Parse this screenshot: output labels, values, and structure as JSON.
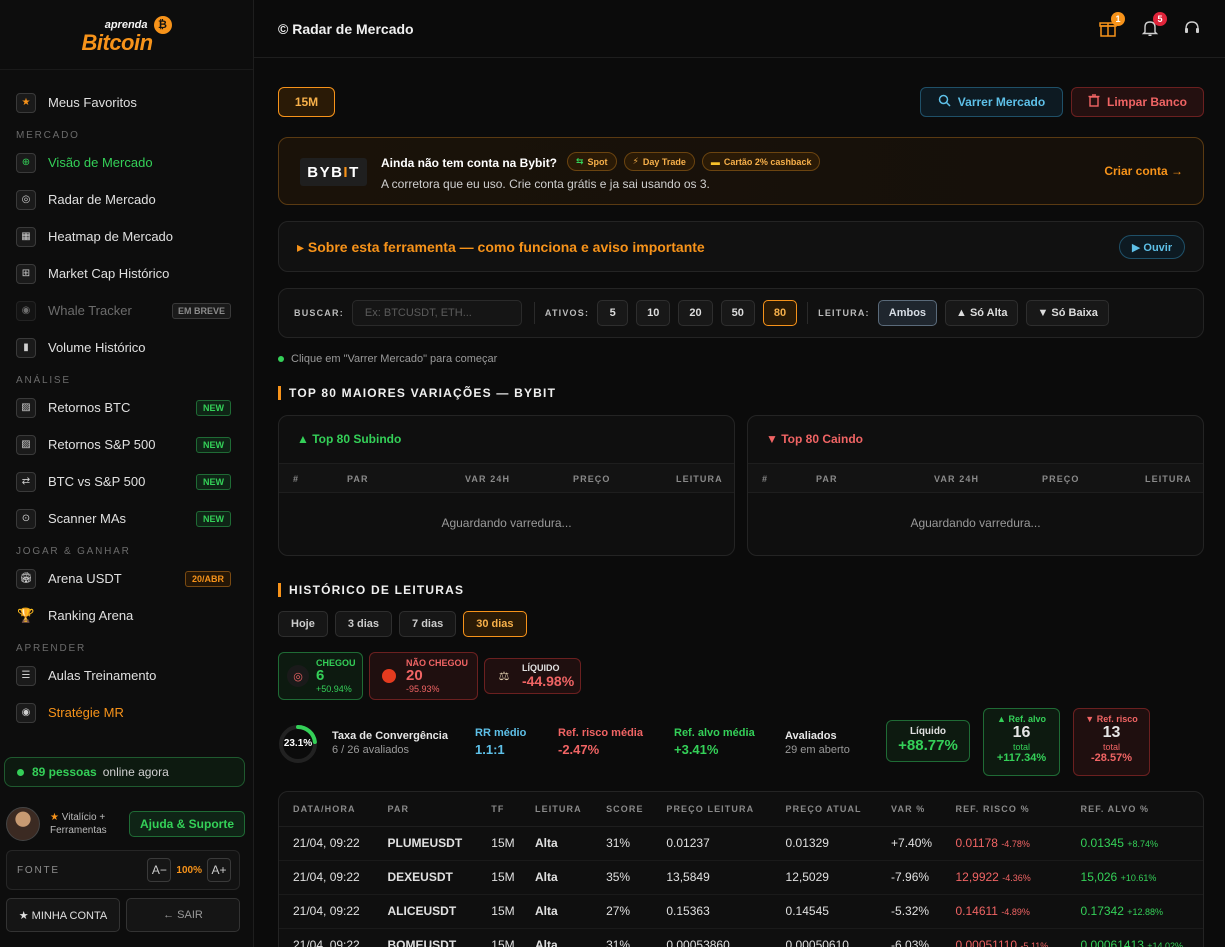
{
  "brand": {
    "top": "aprenda",
    "main": "Bitcoin",
    "coin": "₿"
  },
  "sidebar": {
    "fav": "Meus Favoritos",
    "sec_mercado": "MERCADO",
    "visao": "Visão de Mercado",
    "radar": "Radar de Mercado",
    "heatmap": "Heatmap de Mercado",
    "marketcap": "Market Cap Histórico",
    "whale": "Whale Tracker",
    "whale_badge": "EM BREVE",
    "volume": "Volume Histórico",
    "sec_analise": "ANÁLISE",
    "ret_btc": "Retornos BTC",
    "ret_sp": "Retornos S&P 500",
    "btc_sp": "BTC vs S&P 500",
    "scanner": "Scanner MAs",
    "new": "NEW",
    "sec_jogar": "JOGAR & GANHAR",
    "arena": "Arena USDT",
    "arena_badge": "20/ABR",
    "ranking": "Ranking Arena",
    "sec_aprender": "APRENDER",
    "aulas": "Aulas Treinamento",
    "strategie": "Stratégie MR",
    "online_count": "89 pessoas",
    "online_text": "online agora",
    "plan_line1": "Vitalício +",
    "plan_line2": "Ferramentas",
    "help": "Ajuda & Suporte",
    "font_label": "FONTE",
    "font_minus": "A−",
    "font_value": "100%",
    "font_plus": "A+",
    "account": "★ MINHA CONTA",
    "logout": "← SAIR"
  },
  "header": {
    "title": "© Radar de Mercado",
    "gift_count": "1",
    "bell_count": "5"
  },
  "toolbar": {
    "timeframe": "15M",
    "scan": "Varrer Mercado",
    "clear": "Limpar Banco"
  },
  "promo": {
    "logo_a": "BYB",
    "logo_b": "I",
    "logo_c": "T",
    "title": "Ainda não tem conta na Bybit?",
    "subtitle": "A corretora que eu uso. Crie conta grátis e ja sai usando os 3.",
    "tags": [
      "Spot",
      "Day Trade",
      "Cartão 2% cashback"
    ],
    "cta": "Criar conta →"
  },
  "about": {
    "text": "▸ Sobre esta ferramenta — como funciona e aviso importante",
    "listen": "▶ Ouvir"
  },
  "filters": {
    "search_label": "BUSCAR:",
    "search_placeholder": "Ex: BTCUSDT, ETH...",
    "ativos_label": "ATIVOS:",
    "ativos": [
      "5",
      "10",
      "20",
      "50",
      "80"
    ],
    "leitura_label": "LEITURA:",
    "leitura": [
      "Ambos",
      "▲ Só Alta",
      "▼ Só Baixa"
    ]
  },
  "hint": "Clique em \"Varrer Mercado\" para começar",
  "top": {
    "title": "TOP 80 MAIORES VARIAÇÕES — BYBIT",
    "up_title": "▲ Top 80 Subindo",
    "down_title": "▼ Top 80 Caindo",
    "cols": [
      "#",
      "PAR",
      "VAR 24H",
      "PREÇO",
      "LEITURA"
    ],
    "empty": "Aguardando varredura..."
  },
  "history": {
    "title": "HISTÓRICO DE LEITURAS",
    "ranges": [
      "Hoje",
      "3 dias",
      "7 dias",
      "30 dias"
    ],
    "chegou": {
      "label": "CHEGOU",
      "value": "6",
      "pct": "+50.94%"
    },
    "nao_chegou": {
      "label": "NÃO CHEGOU",
      "value": "20",
      "pct": "-95.93%"
    },
    "liquido": {
      "label": "LÍQUIDO",
      "value": "-44.98%"
    },
    "convergence": {
      "pct": "23.1%",
      "fraction": 0.231,
      "label": "Taxa de Convergência",
      "sub": "6 / 26 avaliados"
    },
    "rr": {
      "label": "RR médio",
      "value": "1.1:1"
    },
    "risk": {
      "label": "Ref. risco média",
      "value": "-2.47%"
    },
    "target": {
      "label": "Ref. alvo média",
      "value": "+3.41%"
    },
    "evaluated": {
      "label": "Avaliados",
      "sub": "29 em aberto"
    },
    "net_box": {
      "label": "Líquido",
      "value": "+88.77%"
    },
    "alvo_box": {
      "label": "▲ Ref. alvo",
      "value": "16",
      "sub": "total",
      "pct": "+117.34%"
    },
    "risco_box": {
      "label": "▼ Ref. risco",
      "value": "13",
      "sub": "total",
      "pct": "-28.57%"
    },
    "cols": [
      "DATA/HORA",
      "PAR",
      "TF",
      "LEITURA",
      "SCORE",
      "PREÇO LEITURA",
      "PREÇO ATUAL",
      "VAR %",
      "REF. RISCO %",
      "REF. ALVO %"
    ],
    "rows": [
      {
        "dt": "21/04, 09:22",
        "par": "PLUMEUSDT",
        "tf": "15M",
        "leitura": "Alta",
        "score": "31%",
        "p_leit": "0.01237",
        "p_atual": "0.01329",
        "var": "+7.40%",
        "risco": "0.01178",
        "risco_pct": "-4.78%",
        "alvo": "0.01345",
        "alvo_pct": "+8.74%"
      },
      {
        "dt": "21/04, 09:22",
        "par": "DEXEUSDT",
        "tf": "15M",
        "leitura": "Alta",
        "score": "35%",
        "p_leit": "13,5849",
        "p_atual": "12,5029",
        "var": "-7.96%",
        "risco": "12,9922",
        "risco_pct": "-4.36%",
        "alvo": "15,026",
        "alvo_pct": "+10.61%"
      },
      {
        "dt": "21/04, 09:22",
        "par": "ALICEUSDT",
        "tf": "15M",
        "leitura": "Alta",
        "score": "27%",
        "p_leit": "0.15363",
        "p_atual": "0.14545",
        "var": "-5.32%",
        "risco": "0.14611",
        "risco_pct": "-4.89%",
        "alvo": "0.17342",
        "alvo_pct": "+12.88%"
      },
      {
        "dt": "21/04, 09:22",
        "par": "BOMEUSDT",
        "tf": "15M",
        "leitura": "Alta",
        "score": "31%",
        "p_leit": "0.00053860",
        "p_atual": "0.00050610",
        "var": "-6.03%",
        "risco": "0.00051110",
        "risco_pct": "-5.11%",
        "alvo": "0.00061413",
        "alvo_pct": "+14.02%"
      }
    ]
  }
}
